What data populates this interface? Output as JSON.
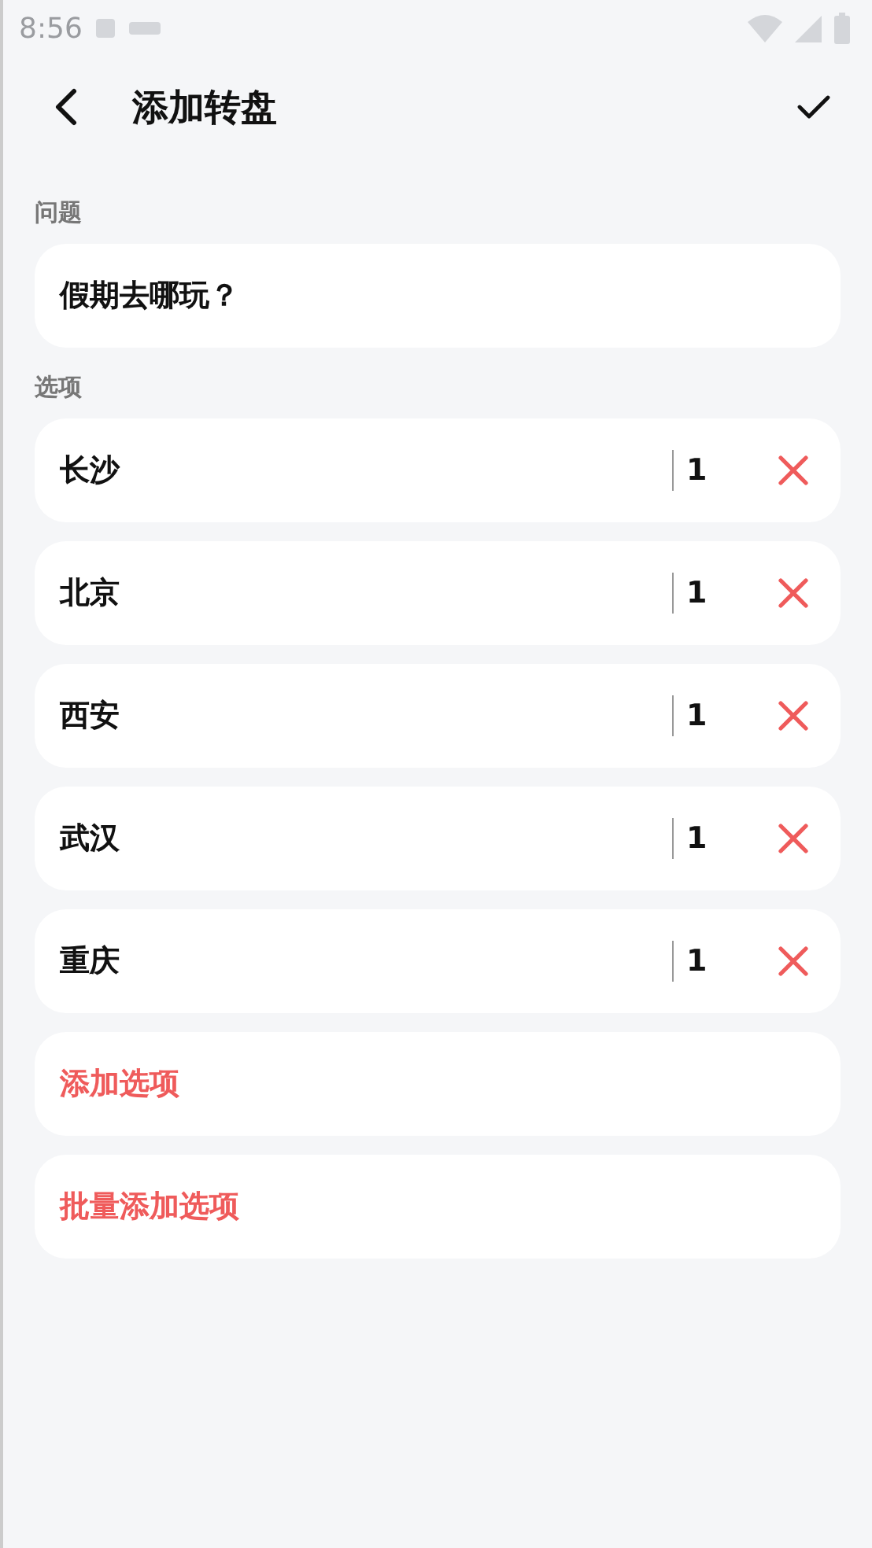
{
  "status_bar": {
    "time": "8:56"
  },
  "header": {
    "title": "添加转盘"
  },
  "question": {
    "label": "问题",
    "value": "假期去哪玩？"
  },
  "options": {
    "label": "选项",
    "items": [
      {
        "name": "长沙",
        "weight": "1"
      },
      {
        "name": "北京",
        "weight": "1"
      },
      {
        "name": "西安",
        "weight": "1"
      },
      {
        "name": "武汉",
        "weight": "1"
      },
      {
        "name": "重庆",
        "weight": "1"
      }
    ]
  },
  "actions": [
    "添加选项",
    "批量添加选项"
  ]
}
